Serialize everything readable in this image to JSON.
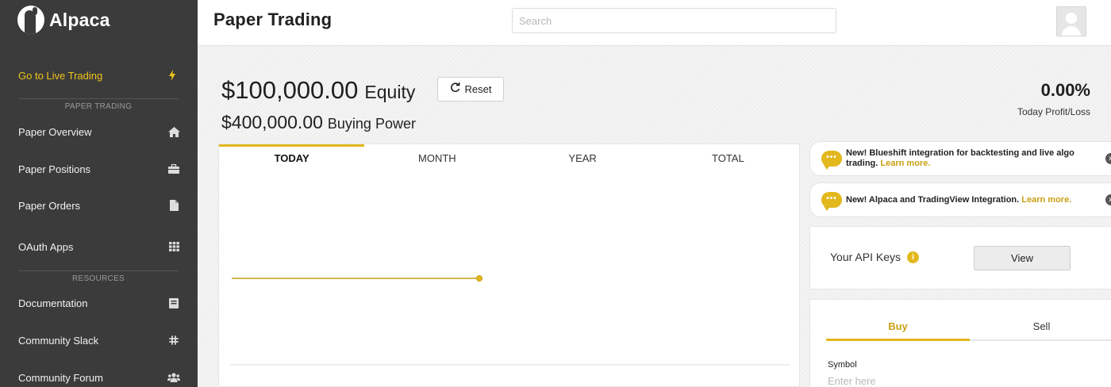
{
  "app": {
    "name": "Alpaca"
  },
  "sidebar": {
    "live_trading": {
      "label": "Go to Live Trading",
      "icon": "bolt-icon"
    },
    "sections": [
      {
        "label": "PAPER TRADING"
      },
      {
        "label": "RESOURCES"
      }
    ],
    "items": [
      {
        "label": "Paper Overview",
        "icon": "home-icon"
      },
      {
        "label": "Paper Positions",
        "icon": "briefcase-icon"
      },
      {
        "label": "Paper Orders",
        "icon": "document-icon"
      },
      {
        "label": "OAuth Apps",
        "icon": "grid-icon"
      },
      {
        "label": "Documentation",
        "icon": "book-icon"
      },
      {
        "label": "Community Slack",
        "icon": "slack-icon"
      },
      {
        "label": "Community Forum",
        "icon": "users-icon"
      }
    ]
  },
  "header": {
    "title": "Paper Trading",
    "search_placeholder": "Search"
  },
  "account": {
    "equity_value": "$100,000.00",
    "equity_label": "Equity",
    "reset_label": "Reset",
    "buying_power_value": "$400,000.00",
    "buying_power_label": "Buying Power",
    "profit_loss_value": "0.00%",
    "profit_loss_label": "Today Profit/Loss"
  },
  "chart_tabs": [
    {
      "label": "TODAY",
      "active": true
    },
    {
      "label": "MONTH",
      "active": false
    },
    {
      "label": "YEAR",
      "active": false
    },
    {
      "label": "TOTAL",
      "active": false
    }
  ],
  "notices": [
    {
      "text": "New! Blueshift integration for backtesting and live algo trading.",
      "link": "Learn more."
    },
    {
      "text": "New! Alpaca and TradingView Integration.",
      "link": "Learn more."
    }
  ],
  "api_keys": {
    "label": "Your API Keys",
    "info_icon": "i",
    "view_label": "View"
  },
  "order": {
    "tabs": [
      {
        "label": "Buy",
        "active": true
      },
      {
        "label": "Sell",
        "active": false
      }
    ],
    "symbol_label": "Symbol",
    "symbol_placeholder": "Enter here"
  },
  "colors": {
    "accent": "#e2b81d",
    "sidebar_bg": "#3b3b3b",
    "live_link": "#f0c419"
  }
}
